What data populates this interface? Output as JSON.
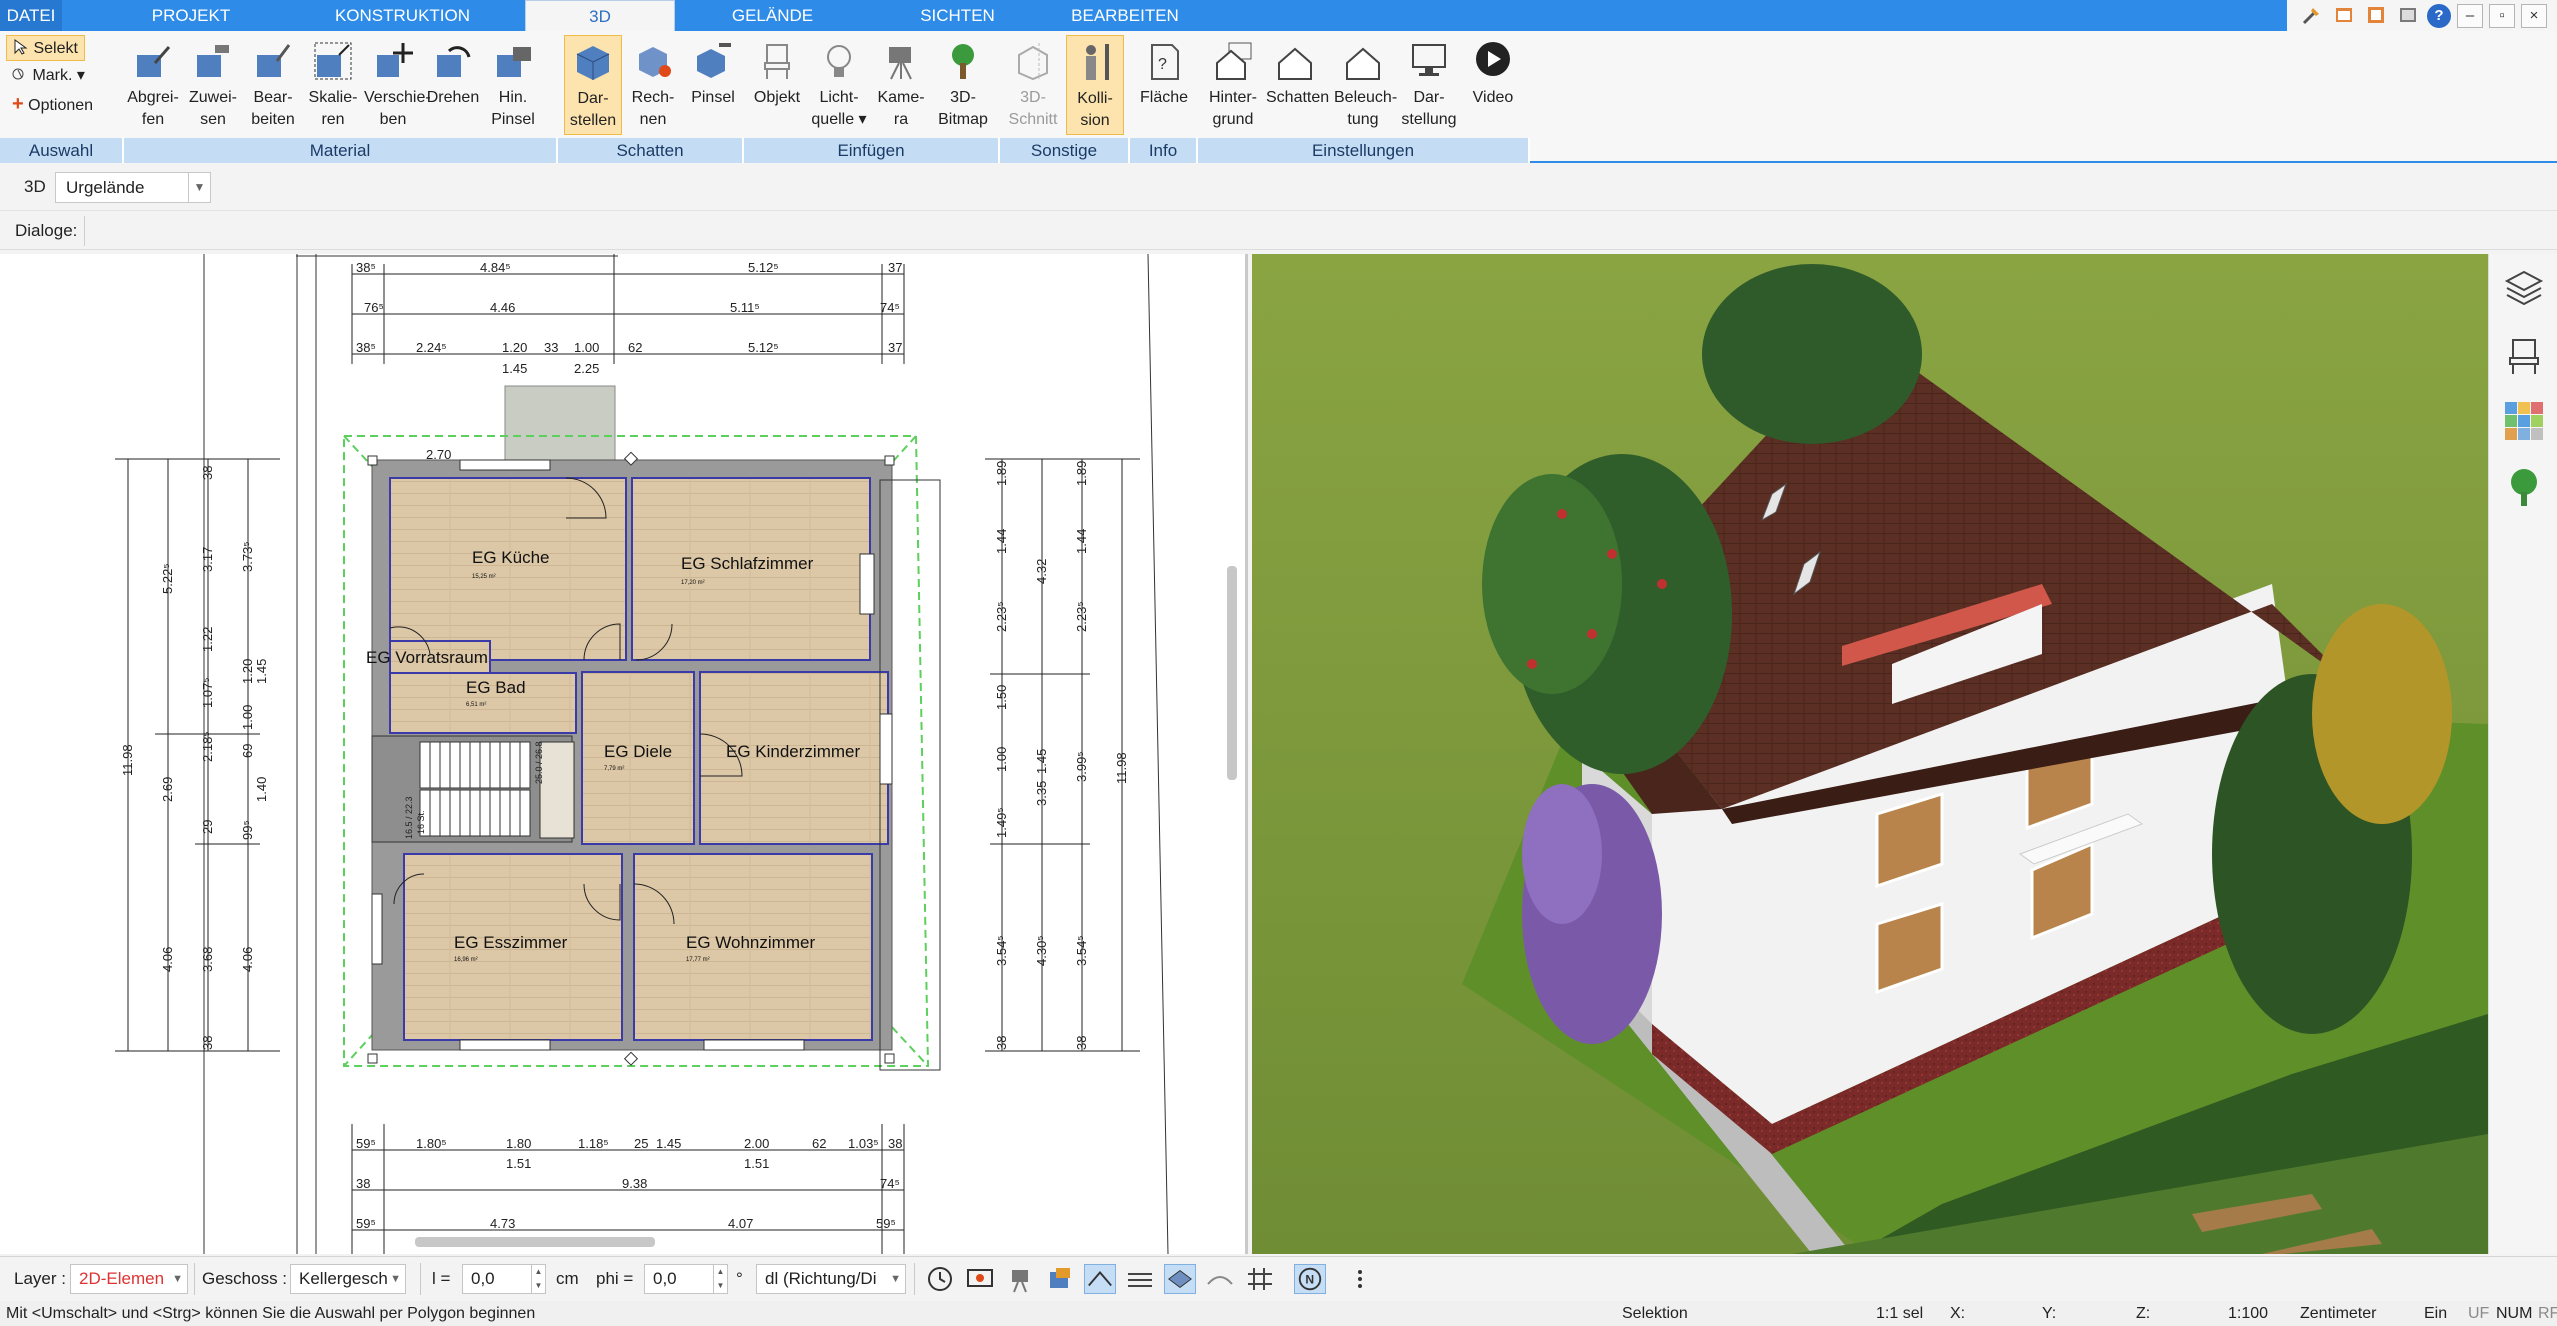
{
  "menu": {
    "tabs": [
      "DATEI",
      "PROJEKT",
      "KONSTRUKTION",
      "3D",
      "GELÄNDE",
      "SICHTEN",
      "BEARBEITEN"
    ],
    "active_tab": "3D"
  },
  "ribbon": {
    "auswahl": {
      "items": [
        "Selekt",
        "Mark.",
        "Optionen"
      ],
      "footer": "Auswahl"
    },
    "material": {
      "buttons": [
        [
          "Abgrei-",
          "fen"
        ],
        [
          "Zuwei-",
          "sen"
        ],
        [
          "Bear-",
          "beiten"
        ],
        [
          "Skalie-",
          "ren"
        ],
        [
          "Verschie-",
          "ben"
        ],
        [
          "Drehen",
          ""
        ],
        [
          "Hin.",
          "Pinsel"
        ]
      ],
      "footer": "Material"
    },
    "schatten": {
      "buttons": [
        [
          "Dar-",
          "stellen"
        ],
        [
          "Rech-",
          "nen"
        ],
        [
          "Pinsel",
          ""
        ]
      ],
      "footer": "Schatten"
    },
    "einfuegen": {
      "buttons": [
        [
          "Objekt",
          ""
        ],
        [
          "Licht-",
          "quelle"
        ],
        [
          "Kame-",
          "ra"
        ],
        [
          "3D-",
          "Bitmap"
        ]
      ],
      "footer": "Einfügen"
    },
    "sonstige": {
      "buttons": [
        [
          "3D-",
          "Schnitt"
        ],
        [
          "Kolli-",
          "sion"
        ]
      ],
      "footer": "Sonstige"
    },
    "info": {
      "buttons": [
        [
          "Fläche",
          ""
        ]
      ],
      "footer": "Info"
    },
    "einstellungen": {
      "buttons": [
        [
          "Hinter-",
          "grund"
        ],
        [
          "Schatten",
          ""
        ],
        [
          "Beleuch-",
          "tung"
        ],
        [
          "Dar-",
          "stellung"
        ],
        [
          "Video",
          ""
        ]
      ],
      "footer": "Einstellungen"
    }
  },
  "viewbar": {
    "label": "3D",
    "selected": "Urgelände"
  },
  "dialogbar": {
    "label": "Dialoge:"
  },
  "plan": {
    "rooms": [
      {
        "name": "EG Küche",
        "area": "15,25 m²"
      },
      {
        "name": "EG Schlafzimmer",
        "area": "17,20 m²"
      },
      {
        "name": "EG Vorratsraum",
        "area": ""
      },
      {
        "name": "EG Bad",
        "area": "6,51 m²"
      },
      {
        "name": "EG Diele",
        "area": "7,79 m²"
      },
      {
        "name": "EG Kinderzimmer",
        "area": ""
      },
      {
        "name": "EG Esszimmer",
        "area": "16,96 m²"
      },
      {
        "name": "EG Wohnzimmer",
        "area": "17,77 m²"
      }
    ],
    "dims_top": {
      "row1": [
        "38⁵",
        "4.84⁵",
        "5.12⁵",
        "37"
      ],
      "row2": [
        "76⁵",
        "4.46",
        "5.11⁵",
        "74⁵"
      ],
      "row3": [
        "38⁵",
        "2.24⁵",
        "1.20",
        "33",
        "1.00",
        "62",
        "5.12⁵",
        "37"
      ],
      "row3b": [
        "1.45",
        "2.25"
      ],
      "entry": "2.70"
    },
    "dims_bottom": {
      "row1": [
        "59⁵",
        "1.80⁵",
        "1.80",
        "1.18⁵",
        "25",
        "1.45",
        "2.00",
        "62",
        "1.03⁵",
        "38"
      ],
      "row1b": [
        "1.51",
        "1.51"
      ],
      "row2": [
        "38",
        "9.38",
        "74⁵"
      ],
      "row3": [
        "59⁵",
        "4.73",
        "4.07",
        "59⁵"
      ]
    },
    "dims_left": {
      "outer": [
        "11.98"
      ],
      "col1": [
        "5.22⁵",
        "2.69",
        "4.06"
      ],
      "col2": [
        "38",
        "3.17",
        "1.22",
        "1.07⁵",
        "2.18⁵",
        "29",
        "3.68",
        "38"
      ],
      "col3": [
        "1.20",
        "1.00",
        "69",
        "99⁵",
        "3.73⁵",
        "1.45",
        "1.40",
        "4.06"
      ]
    },
    "dims_right": {
      "col1": [
        "1.89",
        "1.44",
        "2.23⁵",
        "1.50",
        "1.00",
        "1.49⁵",
        "3.54⁵",
        "38"
      ],
      "col2": [
        "4.32",
        "1.45",
        "3.35",
        "4.30⁵"
      ],
      "col3": [
        "1.89",
        "1.44",
        "2.23⁵",
        "3.99⁵",
        "3.54⁵",
        "38"
      ],
      "outer": [
        "11.98"
      ]
    },
    "stair_labels": [
      "16.5 / 22.3",
      "16 St.",
      "25.0 / 26.8"
    ]
  },
  "bottombar": {
    "layer_label": "Layer :",
    "layer_value": "2D-Elemen",
    "geschoss_label": "Geschoss :",
    "geschoss_value": "Kellergesch",
    "l_label": "l =",
    "l_value": "0,0",
    "unit": "cm",
    "phi_label": "phi =",
    "phi_value": "0,0",
    "deg": "°",
    "direction_value": "dl (Richtung/Di"
  },
  "statusbar": {
    "hint": "Mit <Umschalt> und <Strg> können Sie die Auswahl per Polygon beginnen",
    "mode": "Selektion",
    "selection": "1:1 sel",
    "x": "X:",
    "y": "Y:",
    "z": "Z:",
    "scale": "1:100",
    "unit": "Zentimeter",
    "ein": "Ein",
    "uf": "UF",
    "num": "NUM",
    "rf": "RF"
  },
  "colors": {
    "accent": "#2e8ce8",
    "ribbon_group_footer": "#c4ddf5",
    "active_button": "#fde4ae",
    "wall": "#9a9a9a",
    "floor": "#d8c2a2",
    "room_outline": "#3a3aa8",
    "roof": "#5b2f24",
    "lawn": "#7f9a3c"
  }
}
